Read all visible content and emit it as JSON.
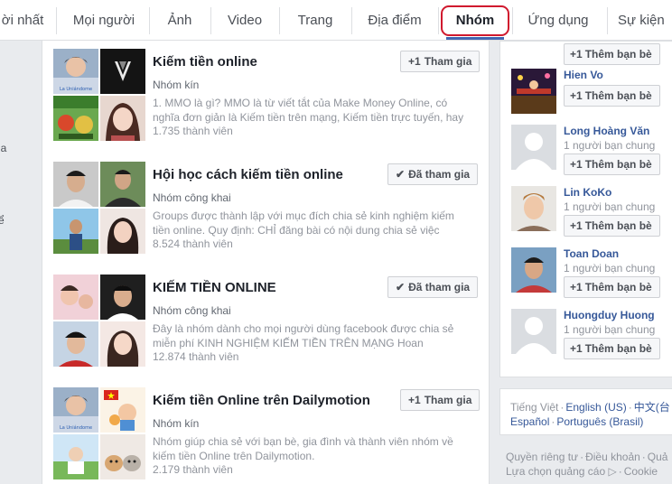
{
  "tabs": [
    {
      "label": "ời nhất"
    },
    {
      "label": "Mọi người"
    },
    {
      "label": "Ảnh"
    },
    {
      "label": "Video"
    },
    {
      "label": "Trang"
    },
    {
      "label": "Địa điểm"
    },
    {
      "label": "Nhóm",
      "active": true
    },
    {
      "label": "Ứng dụng"
    },
    {
      "label": "Sự kiện"
    }
  ],
  "left_sliver": [
    "ia",
    "ể"
  ],
  "groups": [
    {
      "title": "Kiếm tiền online",
      "privacy": "Nhóm kín",
      "description": "1. MMO là gì? MMO là từ viết tắt của Make Money Online, có nghĩa đơn giản là Kiếm tiền trên mạng, Kiếm tiền trực tuyến, hay Kiếm...",
      "members": "1.735 thành viên",
      "button": "Tham gia",
      "button_icon": "+1",
      "joined": false
    },
    {
      "title": "Hội học cách kiếm tiền online",
      "privacy": "Nhóm công khai",
      "description": "Groups được thành lập với mục đích chia sẻ kinh nghiệm kiếm tiền online. Quy định: CHỈ đăng bài có nội dung chia sẻ việc kiếm...",
      "members": "8.524 thành viên",
      "button": "Đã tham gia",
      "button_icon": "✔",
      "joined": true
    },
    {
      "title": "KIẾM TIỀN ONLINE",
      "privacy": "Nhóm công khai",
      "description": "Đây là nhóm dành cho mọi người dùng facebook được chia sẻ miễn phí KINH NGHIỆM KIẾM TIỀN TRÊN MẠNG Hoan nghênh...",
      "members": "12.874 thành viên",
      "button": "Đã tham gia",
      "button_icon": "✔",
      "joined": true
    },
    {
      "title": "Kiếm tiền Online trên Dailymotion",
      "privacy": "Nhóm kín",
      "description": "Nhóm giúp chia sẻ với bạn bè, gia đình và thành viên nhóm về kiếm tiền Online trên Dailymotion.",
      "members": "2.179 thành viên",
      "button": "Tham gia",
      "button_icon": "+1",
      "joined": false
    }
  ],
  "add_friend_label": "Thêm bạn bè",
  "add_friend_icon": "+1",
  "people": [
    {
      "name": "",
      "mutual": ""
    },
    {
      "name": "Hien Vo",
      "mutual": ""
    },
    {
      "name": "Long Hoàng Văn",
      "mutual": "1 người bạn chung"
    },
    {
      "name": "Lin KoKo",
      "mutual": "1 người bạn chung"
    },
    {
      "name": "Toan Doan",
      "mutual": "1 người bạn chung"
    },
    {
      "name": "Huongduy Huong",
      "mutual": "1 người bạn chung"
    }
  ],
  "languages": {
    "current": "Tiếng Việt",
    "others": [
      "English (US)",
      "中文(台",
      "Español",
      "Português (Brasil)"
    ]
  },
  "footer": {
    "line1": [
      "Quyền riêng tư",
      "Điều khoản",
      "Quả"
    ],
    "line2": [
      "Lựa chọn quảng cáo",
      "Cookie"
    ]
  },
  "colors": {
    "link": "#365899",
    "highlight_circle": "#d0192e",
    "page_bg": "#e9ebee"
  }
}
